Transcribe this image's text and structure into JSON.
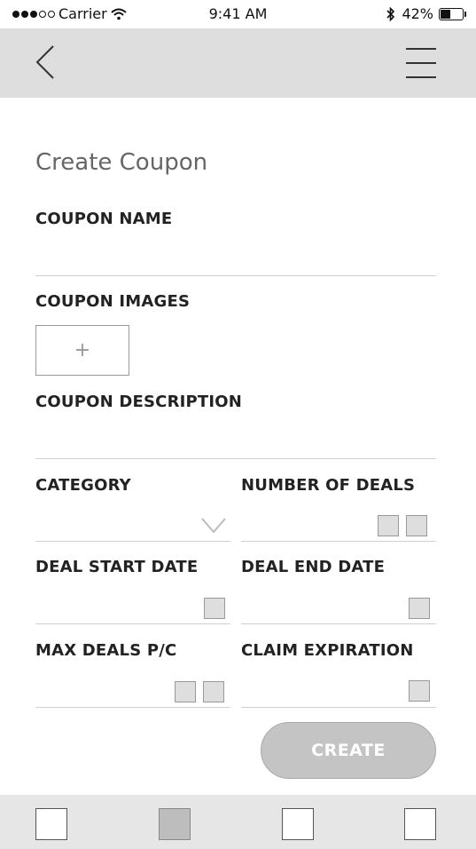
{
  "status_bar": {
    "carrier": "Carrier",
    "time": "9:41 AM",
    "battery": "42%",
    "battery_level": 0.42
  },
  "nav": {
    "back_icon": "chevron-left-icon",
    "menu_icon": "hamburger-menu-icon"
  },
  "page": {
    "title": "Create Coupon"
  },
  "form": {
    "coupon_name_label": "COUPON NAME",
    "coupon_images_label": "COUPON IMAGES",
    "add_image_symbol": "+",
    "coupon_description_label": "COUPON DESCRIPTION",
    "category_label": "CATEGORY",
    "number_of_deals_label": "NUMBER OF DEALS",
    "deal_start_date_label": "DEAL START DATE",
    "deal_end_date_label": "DEAL END DATE",
    "max_deals_label": "MAX DEALS P/C",
    "claim_expiration_label": "CLAIM EXPIRATION"
  },
  "actions": {
    "create_label": "CREATE"
  },
  "tab_bar": {
    "tabs": [
      "tab-1",
      "tab-2",
      "tab-3",
      "tab-4"
    ],
    "active_index": 1
  }
}
